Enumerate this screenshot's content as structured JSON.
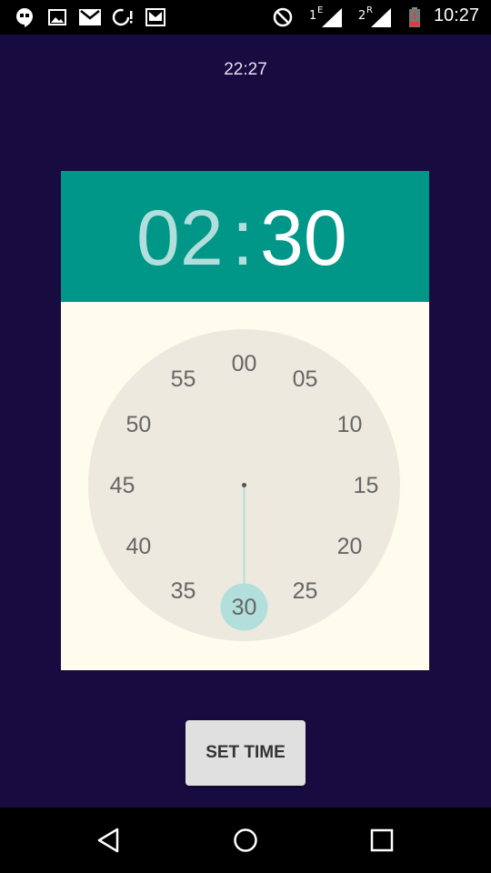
{
  "status_bar": {
    "time": "10:27",
    "left_icons": [
      "hangouts-icon",
      "image-icon",
      "gmail-icon",
      "sync-alert-icon",
      "inbox-icon"
    ],
    "right_icons": [
      "do-not-disturb-icon",
      "signal-1-icon",
      "signal-2-icon",
      "battery-low-icon"
    ],
    "sim1_label": "1",
    "sim1_type": "E",
    "sim2_label": "2",
    "sim2_type": "R"
  },
  "top_time": "22:27",
  "picker": {
    "hours": "02",
    "separator": ":",
    "minutes": "30",
    "selected_minute": "30",
    "minute_labels": [
      "00",
      "05",
      "10",
      "15",
      "20",
      "25",
      "30",
      "35",
      "40",
      "45",
      "50",
      "55"
    ],
    "colors": {
      "header": "#009688",
      "selection": "#b2dfdb",
      "face": "#ede9df",
      "card": "#fefcec"
    }
  },
  "set_time_button": {
    "label": "SET TIME"
  },
  "nav_bar": {
    "icons": [
      "back-icon",
      "home-icon",
      "recents-icon"
    ]
  }
}
